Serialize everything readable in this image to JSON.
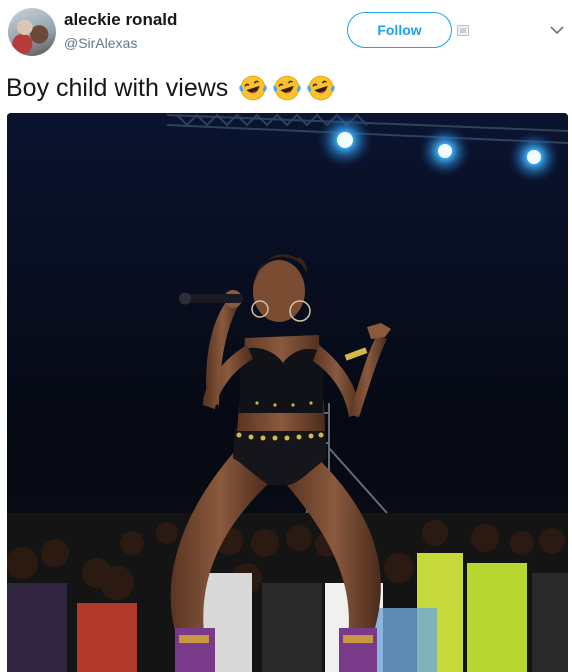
{
  "tweet": {
    "author": {
      "display_name": "aleckie ronald",
      "handle": "@SirAlexas"
    },
    "follow_label": "Follow",
    "text": "Boy child with views",
    "emoji": [
      "laughing-crying-face",
      "laughing-crying-face",
      "laughing-crying-face"
    ]
  },
  "icons": {
    "menu": "chevron-down-icon",
    "card": "card-icon"
  },
  "colors": {
    "accent": "#1da1f2",
    "text_primary": "#14171a",
    "text_secondary": "#657786",
    "stage_light": "#2aa8ff"
  }
}
